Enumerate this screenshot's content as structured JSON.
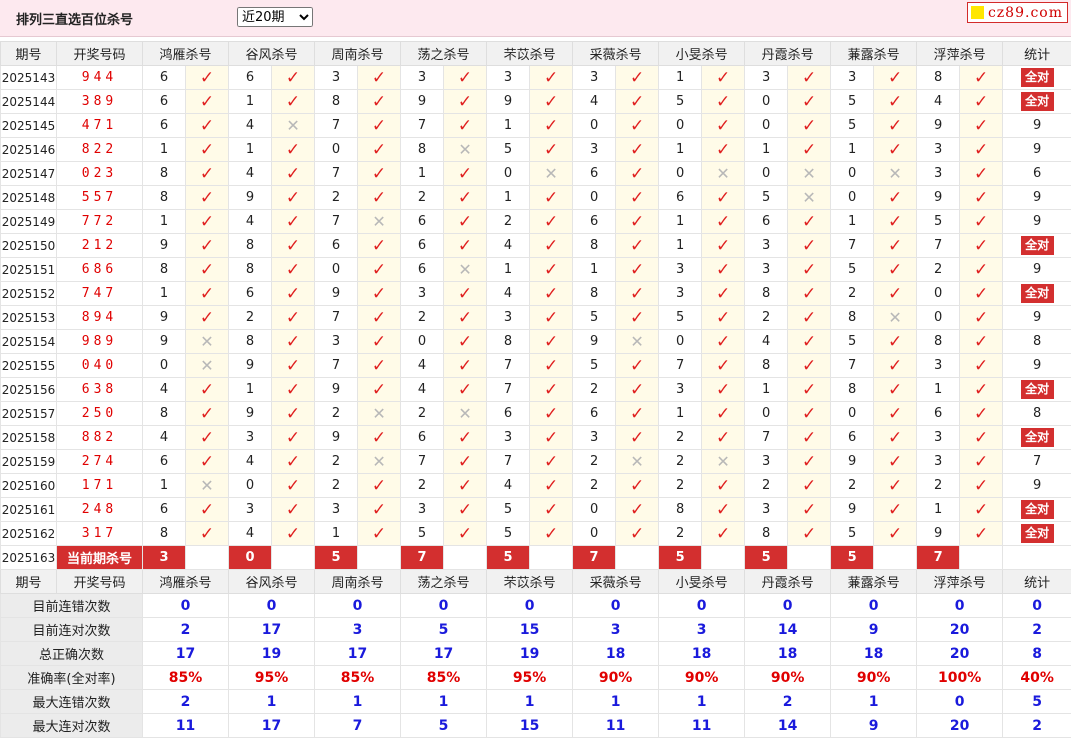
{
  "header": {
    "title": "排列三直选百位杀号",
    "period_select": "近20期",
    "logo_text": "cz89.com"
  },
  "columns": {
    "period": "期号",
    "winning": "开奖号码",
    "experts": [
      "鸿雁杀号",
      "谷风杀号",
      "周南杀号",
      "荡之杀号",
      "芣苡杀号",
      "采薇杀号",
      "小旻杀号",
      "丹霞杀号",
      "蒹露杀号",
      "浮萍杀号"
    ],
    "stat": "统计"
  },
  "rows": [
    {
      "period": "2025143",
      "winning": "944",
      "kills": [
        [
          6,
          1
        ],
        [
          6,
          1
        ],
        [
          3,
          1
        ],
        [
          3,
          1
        ],
        [
          3,
          1
        ],
        [
          3,
          1
        ],
        [
          1,
          1
        ],
        [
          3,
          1
        ],
        [
          3,
          1
        ],
        [
          8,
          1
        ]
      ],
      "stat": "全对"
    },
    {
      "period": "2025144",
      "winning": "389",
      "kills": [
        [
          6,
          1
        ],
        [
          1,
          1
        ],
        [
          8,
          1
        ],
        [
          9,
          1
        ],
        [
          9,
          1
        ],
        [
          4,
          1
        ],
        [
          5,
          1
        ],
        [
          0,
          1
        ],
        [
          5,
          1
        ],
        [
          4,
          1
        ]
      ],
      "stat": "全对"
    },
    {
      "period": "2025145",
      "winning": "471",
      "kills": [
        [
          6,
          1
        ],
        [
          4,
          0
        ],
        [
          7,
          1
        ],
        [
          7,
          1
        ],
        [
          1,
          1
        ],
        [
          0,
          1
        ],
        [
          0,
          1
        ],
        [
          0,
          1
        ],
        [
          5,
          1
        ],
        [
          9,
          1
        ]
      ],
      "stat": "9"
    },
    {
      "period": "2025146",
      "winning": "822",
      "kills": [
        [
          1,
          1
        ],
        [
          1,
          1
        ],
        [
          0,
          1
        ],
        [
          8,
          0
        ],
        [
          5,
          1
        ],
        [
          3,
          1
        ],
        [
          1,
          1
        ],
        [
          1,
          1
        ],
        [
          1,
          1
        ],
        [
          3,
          1
        ]
      ],
      "stat": "9"
    },
    {
      "period": "2025147",
      "winning": "023",
      "kills": [
        [
          8,
          1
        ],
        [
          4,
          1
        ],
        [
          7,
          1
        ],
        [
          1,
          1
        ],
        [
          0,
          0
        ],
        [
          6,
          1
        ],
        [
          0,
          0
        ],
        [
          0,
          0
        ],
        [
          0,
          0
        ],
        [
          3,
          1
        ]
      ],
      "stat": "6"
    },
    {
      "period": "2025148",
      "winning": "557",
      "kills": [
        [
          8,
          1
        ],
        [
          9,
          1
        ],
        [
          2,
          1
        ],
        [
          2,
          1
        ],
        [
          1,
          1
        ],
        [
          0,
          1
        ],
        [
          6,
          1
        ],
        [
          5,
          0
        ],
        [
          0,
          1
        ],
        [
          9,
          1
        ]
      ],
      "stat": "9"
    },
    {
      "period": "2025149",
      "winning": "772",
      "kills": [
        [
          1,
          1
        ],
        [
          4,
          1
        ],
        [
          7,
          0
        ],
        [
          6,
          1
        ],
        [
          2,
          1
        ],
        [
          6,
          1
        ],
        [
          1,
          1
        ],
        [
          6,
          1
        ],
        [
          1,
          1
        ],
        [
          5,
          1
        ]
      ],
      "stat": "9"
    },
    {
      "period": "2025150",
      "winning": "212",
      "kills": [
        [
          9,
          1
        ],
        [
          8,
          1
        ],
        [
          6,
          1
        ],
        [
          6,
          1
        ],
        [
          4,
          1
        ],
        [
          8,
          1
        ],
        [
          1,
          1
        ],
        [
          3,
          1
        ],
        [
          7,
          1
        ],
        [
          7,
          1
        ]
      ],
      "stat": "全对"
    },
    {
      "period": "2025151",
      "winning": "686",
      "kills": [
        [
          8,
          1
        ],
        [
          8,
          1
        ],
        [
          0,
          1
        ],
        [
          6,
          0
        ],
        [
          1,
          1
        ],
        [
          1,
          1
        ],
        [
          3,
          1
        ],
        [
          3,
          1
        ],
        [
          5,
          1
        ],
        [
          2,
          1
        ]
      ],
      "stat": "9"
    },
    {
      "period": "2025152",
      "winning": "747",
      "kills": [
        [
          1,
          1
        ],
        [
          6,
          1
        ],
        [
          9,
          1
        ],
        [
          3,
          1
        ],
        [
          4,
          1
        ],
        [
          8,
          1
        ],
        [
          3,
          1
        ],
        [
          8,
          1
        ],
        [
          2,
          1
        ],
        [
          0,
          1
        ]
      ],
      "stat": "全对"
    },
    {
      "period": "2025153",
      "winning": "894",
      "kills": [
        [
          9,
          1
        ],
        [
          2,
          1
        ],
        [
          7,
          1
        ],
        [
          2,
          1
        ],
        [
          3,
          1
        ],
        [
          5,
          1
        ],
        [
          5,
          1
        ],
        [
          2,
          1
        ],
        [
          8,
          0
        ],
        [
          0,
          1
        ]
      ],
      "stat": "9"
    },
    {
      "period": "2025154",
      "winning": "989",
      "kills": [
        [
          9,
          0
        ],
        [
          8,
          1
        ],
        [
          3,
          1
        ],
        [
          0,
          1
        ],
        [
          8,
          1
        ],
        [
          9,
          0
        ],
        [
          0,
          1
        ],
        [
          4,
          1
        ],
        [
          5,
          1
        ],
        [
          8,
          1
        ]
      ],
      "stat": "8"
    },
    {
      "period": "2025155",
      "winning": "040",
      "kills": [
        [
          0,
          0
        ],
        [
          9,
          1
        ],
        [
          7,
          1
        ],
        [
          4,
          1
        ],
        [
          7,
          1
        ],
        [
          5,
          1
        ],
        [
          7,
          1
        ],
        [
          8,
          1
        ],
        [
          7,
          1
        ],
        [
          3,
          1
        ]
      ],
      "stat": "9"
    },
    {
      "period": "2025156",
      "winning": "638",
      "kills": [
        [
          4,
          1
        ],
        [
          1,
          1
        ],
        [
          9,
          1
        ],
        [
          4,
          1
        ],
        [
          7,
          1
        ],
        [
          2,
          1
        ],
        [
          3,
          1
        ],
        [
          1,
          1
        ],
        [
          8,
          1
        ],
        [
          1,
          1
        ]
      ],
      "stat": "全对"
    },
    {
      "period": "2025157",
      "winning": "250",
      "kills": [
        [
          8,
          1
        ],
        [
          9,
          1
        ],
        [
          2,
          0
        ],
        [
          2,
          0
        ],
        [
          6,
          1
        ],
        [
          6,
          1
        ],
        [
          1,
          1
        ],
        [
          0,
          1
        ],
        [
          0,
          1
        ],
        [
          6,
          1
        ]
      ],
      "stat": "8"
    },
    {
      "period": "2025158",
      "winning": "882",
      "kills": [
        [
          4,
          1
        ],
        [
          3,
          1
        ],
        [
          9,
          1
        ],
        [
          6,
          1
        ],
        [
          3,
          1
        ],
        [
          3,
          1
        ],
        [
          2,
          1
        ],
        [
          7,
          1
        ],
        [
          6,
          1
        ],
        [
          3,
          1
        ]
      ],
      "stat": "全对"
    },
    {
      "period": "2025159",
      "winning": "274",
      "kills": [
        [
          6,
          1
        ],
        [
          4,
          1
        ],
        [
          2,
          0
        ],
        [
          7,
          1
        ],
        [
          7,
          1
        ],
        [
          2,
          0
        ],
        [
          2,
          0
        ],
        [
          3,
          1
        ],
        [
          9,
          1
        ],
        [
          3,
          1
        ]
      ],
      "stat": "7"
    },
    {
      "period": "2025160",
      "winning": "171",
      "kills": [
        [
          1,
          0
        ],
        [
          0,
          1
        ],
        [
          2,
          1
        ],
        [
          2,
          1
        ],
        [
          4,
          1
        ],
        [
          2,
          1
        ],
        [
          2,
          1
        ],
        [
          2,
          1
        ],
        [
          2,
          1
        ],
        [
          2,
          1
        ]
      ],
      "stat": "9"
    },
    {
      "period": "2025161",
      "winning": "248",
      "kills": [
        [
          6,
          1
        ],
        [
          3,
          1
        ],
        [
          3,
          1
        ],
        [
          3,
          1
        ],
        [
          5,
          1
        ],
        [
          0,
          1
        ],
        [
          8,
          1
        ],
        [
          3,
          1
        ],
        [
          9,
          1
        ],
        [
          1,
          1
        ]
      ],
      "stat": "全对"
    },
    {
      "period": "2025162",
      "winning": "317",
      "kills": [
        [
          8,
          1
        ],
        [
          4,
          1
        ],
        [
          1,
          1
        ],
        [
          5,
          1
        ],
        [
          5,
          1
        ],
        [
          0,
          1
        ],
        [
          2,
          1
        ],
        [
          8,
          1
        ],
        [
          5,
          1
        ],
        [
          9,
          1
        ]
      ],
      "stat": "全对"
    }
  ],
  "current": {
    "period": "2025163",
    "label": "当前期杀号",
    "kills": [
      "3",
      "0",
      "5",
      "7",
      "5",
      "7",
      "5",
      "5",
      "5",
      "7"
    ]
  },
  "summary": [
    {
      "label": "目前连错次数",
      "values": [
        "0",
        "0",
        "0",
        "0",
        "0",
        "0",
        "0",
        "0",
        "0",
        "0"
      ],
      "stat": "0"
    },
    {
      "label": "目前连对次数",
      "values": [
        "2",
        "17",
        "3",
        "5",
        "15",
        "3",
        "3",
        "14",
        "9",
        "20"
      ],
      "stat": "2"
    },
    {
      "label": "总正确次数",
      "values": [
        "17",
        "19",
        "17",
        "17",
        "19",
        "18",
        "18",
        "18",
        "18",
        "20"
      ],
      "stat": "8"
    },
    {
      "label": "准确率(全对率)",
      "values": [
        "85%",
        "95%",
        "85%",
        "85%",
        "95%",
        "90%",
        "90%",
        "90%",
        "90%",
        "100%"
      ],
      "stat": "40%"
    },
    {
      "label": "最大连错次数",
      "values": [
        "2",
        "1",
        "1",
        "1",
        "1",
        "1",
        "1",
        "2",
        "1",
        "0"
      ],
      "stat": "5"
    },
    {
      "label": "最大连对次数",
      "values": [
        "11",
        "17",
        "7",
        "5",
        "15",
        "11",
        "11",
        "14",
        "9",
        "20"
      ],
      "stat": "2"
    }
  ],
  "icons": {
    "tick": "check-icon",
    "cross": "cross-icon"
  },
  "colors": {
    "accent_red": "#d32f2f",
    "tick_red": "#e02020",
    "summary_blue": "#1a1adc",
    "header_pink": "#fde9ef"
  }
}
